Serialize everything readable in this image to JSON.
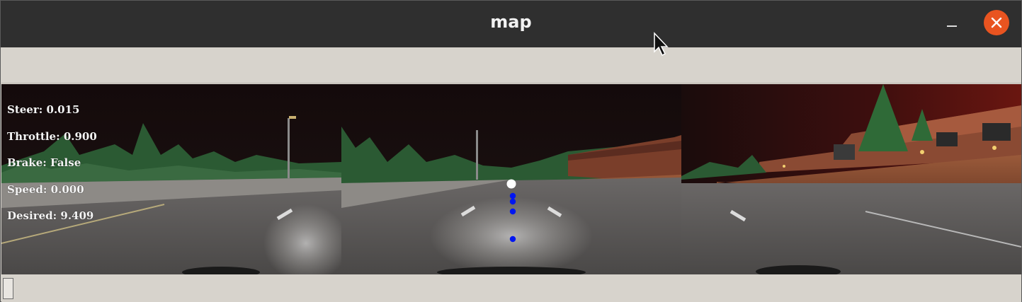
{
  "window": {
    "title": "map"
  },
  "telemetry": {
    "steer": "Steer: 0.015",
    "throttle": "Throttle: 0.900",
    "brake": "Brake: False",
    "speed": "Speed: 0.000",
    "desired": "Desired: 9.409"
  },
  "cameras": [
    {
      "name": "left-camera"
    },
    {
      "name": "center-camera"
    },
    {
      "name": "right-camera"
    }
  ],
  "waypoints": {
    "color": "#0016f0",
    "target_color": "#ffffff",
    "count": 5
  },
  "colors": {
    "titlebar": "#2f2f2f",
    "close_button": "#e95420",
    "panel": "#d7d3cc"
  },
  "icons": {
    "close": "close-icon",
    "minimize": "minimize-icon",
    "cursor": "mouse-pointer-icon"
  }
}
